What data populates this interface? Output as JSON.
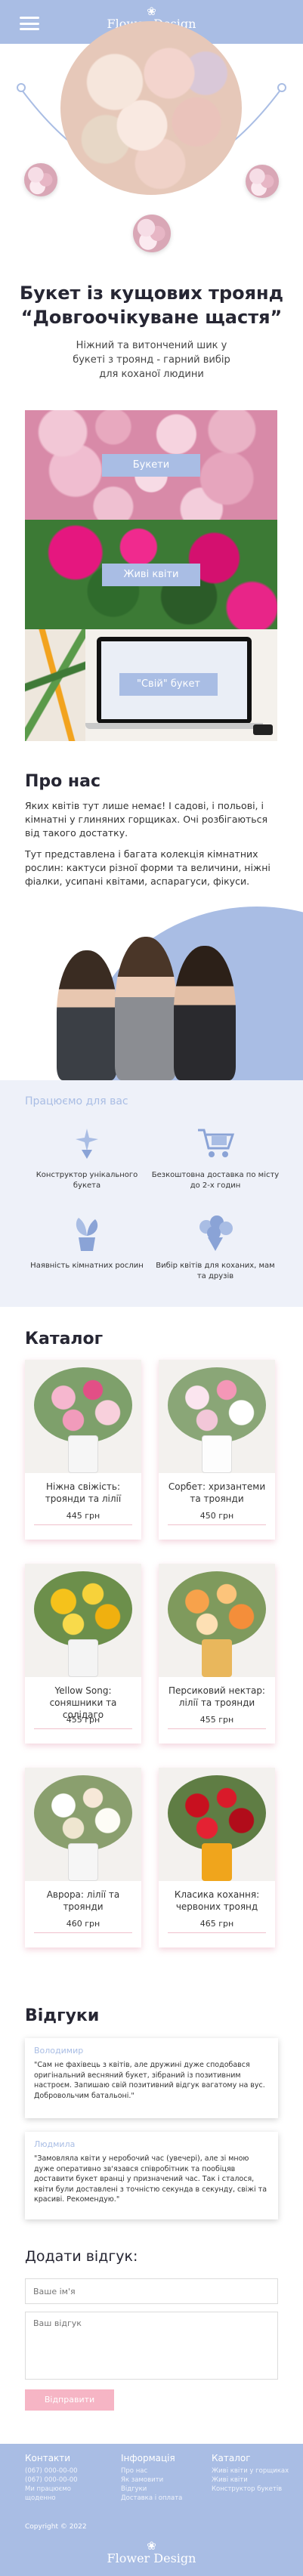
{
  "header": {
    "brand_name": "Flower Design",
    "brand_glyph": "❀"
  },
  "hero": {
    "title_line1": "Букет із кущових троянд",
    "title_line2": "“Довгоочікуване щастя”",
    "subtitle": "Ніжний та витончений шик у букеті з троянд - гарний вибір для коханої людини"
  },
  "promos": [
    {
      "label": "Букети"
    },
    {
      "label": "Живі квіти"
    },
    {
      "label": "\"Свій\" букет"
    }
  ],
  "about": {
    "title": "Про нас",
    "paragraph1": "Яких квітів тут лише немає! І садові, і польові, і кімнатні у глиняних горщиках. Очі розбігаються від такого достатку.",
    "paragraph2": "Тут представлена і багата колекція кімнатних рослин: кактуси різної форми та величини, ніжні фіалки, усипані квітами, аспарагуси, фікуси."
  },
  "services": {
    "title": "Працюємо для вас",
    "items": [
      {
        "label": "Конструктор унікального букета",
        "icon": "sparkle-bouquet-icon"
      },
      {
        "label": "Безкоштовна доставка по місту до 2-х годин",
        "icon": "cart-icon"
      },
      {
        "label": "Наявність кімнатних рослин",
        "icon": "plant-pot-icon"
      },
      {
        "label": "Вибір квітів для коханих, мам та друзів",
        "icon": "bouquet-icon"
      }
    ]
  },
  "catalog": {
    "title": "Каталог",
    "items": [
      {
        "name": "Ніжна свіжість: троянди та лілії",
        "price": "445 грн"
      },
      {
        "name": "Сорбет: хризантеми та троянди",
        "price": "450 грн"
      },
      {
        "name": "Yellow Song: соняшники та солідаго",
        "price": "455 грн"
      },
      {
        "name": "Персиковий нектар: лілії та троянди",
        "price": "455 грн"
      },
      {
        "name": "Аврора: лілії та троянди",
        "price": "460 грн"
      },
      {
        "name": "Класика кохання: червоних троянд",
        "price": "465 грн"
      }
    ]
  },
  "reviews": {
    "title": "Відгуки",
    "items": [
      {
        "author": "Володимир",
        "text": "\"Сам не фахівець з квітів, але дружині дуже сподобався оригінальний весняний букет, зібраний із позитивним настроєм. Запишаю свій позитивний відгук вагатому на вус. Добровольчим батальоні.\""
      },
      {
        "author": "Людмила",
        "text": "\"Замовляла квіти у неробочий час (увечері), але зі мною дуже оперативно зв'язався співробітник та пообіцяв доставити букет вранці у призначений час. Так і сталося, квіти були доставлені з точністю секунда в секунду, свіжі та красиві. Рекомендую.\""
      }
    ]
  },
  "feedback_form": {
    "title": "Додати відгук:",
    "name_placeholder": "Ваше ім'я",
    "review_placeholder": "Ваш відгук",
    "submit_label": "Відправити"
  },
  "footer": {
    "columns": [
      {
        "heading": "Контакти",
        "items": [
          "(067) 000-00-00",
          "(067) 000-00-00",
          "Ми працюємо",
          "щоденно"
        ]
      },
      {
        "heading": "Інформація",
        "items": [
          "Про нас",
          "Як замовити",
          "Відгуки",
          "Доставка і оплата"
        ]
      },
      {
        "heading": "Каталог",
        "items": [
          "Живі квіти у горщиках",
          "Живі квіти",
          "Конструктор букетів"
        ]
      }
    ],
    "copyright": "Copyright © 2022",
    "brand_name": "Flower Design",
    "brand_glyph": "❀"
  },
  "colors": {
    "accent": "#a9bde4",
    "button_pink": "#f6b5c5",
    "services_bg": "#eef1f9"
  }
}
